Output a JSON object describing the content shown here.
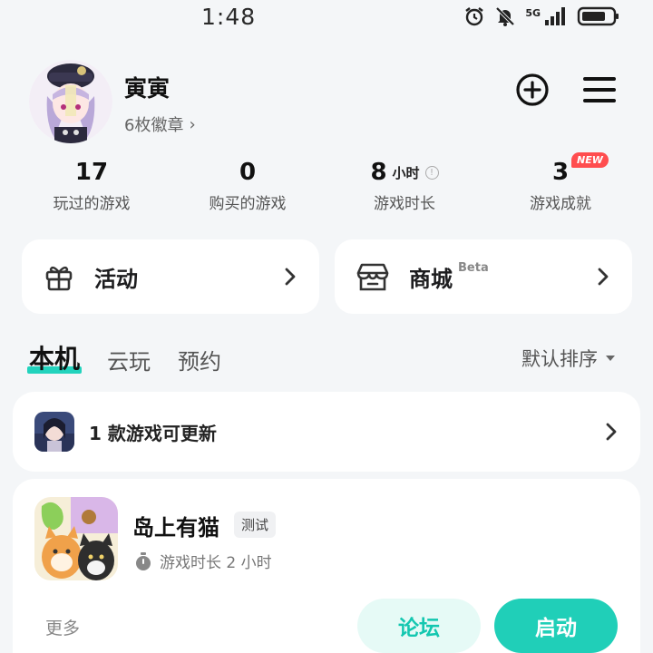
{
  "status_bar": {
    "time": "1:48",
    "network": "5G",
    "icons": [
      "alarm-icon",
      "mute-icon",
      "signal-icon",
      "battery-icon"
    ]
  },
  "profile": {
    "username": "寅寅",
    "badges": "6枚徽章",
    "badges_chevron": "›"
  },
  "stats": [
    {
      "value": "17",
      "unit": "",
      "label": "玩过的游戏"
    },
    {
      "value": "0",
      "unit": "",
      "label": "购买的游戏"
    },
    {
      "value": "8",
      "unit": "小时",
      "label": "游戏时长"
    },
    {
      "value": "3",
      "unit": "",
      "label": "游戏成就",
      "badge": "NEW"
    }
  ],
  "quick_cards": {
    "activity": {
      "label": "活动",
      "icon": "gift-icon"
    },
    "store": {
      "label": "商城",
      "suffix": "Beta",
      "icon": "store-icon"
    }
  },
  "tabs": [
    {
      "label": "本机",
      "active": true
    },
    {
      "label": "云玩",
      "active": false
    },
    {
      "label": "预约",
      "active": false
    }
  ],
  "sort": {
    "label": "默认排序"
  },
  "update_banner": {
    "text": "1 款游戏可更新"
  },
  "game": {
    "title": "岛上有猫",
    "tag": "测试",
    "playtime": "游戏时长 2 小时",
    "more": "更多",
    "forum_label": "论坛",
    "launch_label": "启动"
  },
  "colors": {
    "accent": "#20cfb8",
    "accent_light": "#e6faf6",
    "badge_red": "#ff4d4f",
    "background": "#f4f6f8"
  }
}
